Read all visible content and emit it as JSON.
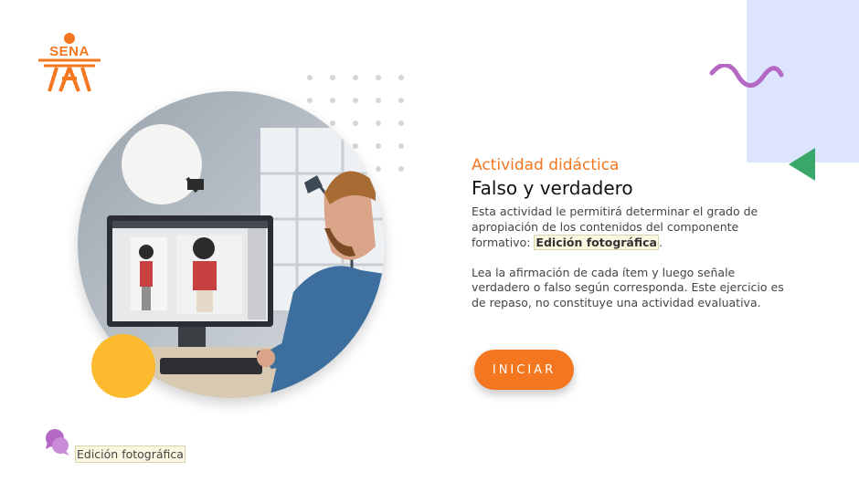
{
  "colors": {
    "brand_orange": "#f4771f",
    "accent_purple": "#b468c4",
    "light_blue": "#dce5fd",
    "green": "#3aa86b",
    "yellow": "#fcba2e",
    "dot_gray": "#d6d6d6",
    "text_dark": "#111111",
    "text_body": "#444444"
  },
  "logo": {
    "text": "SENA"
  },
  "activity": {
    "subtitle": "Actividad didáctica",
    "title": "Falso y verdadero",
    "description_prefix": "Esta actividad le permitirá determinar el grado de apropiación de los contenidos del componente formativo: ",
    "description_tag": "Edición fotográfica",
    "description_suffix": ".",
    "instructions": "Lea la afirmación de cada ítem y luego señale verdadero o falso según corresponda.  Este ejercicio es de repaso, no constituye una actividad evaluativa."
  },
  "start_button": {
    "label": "INICIAR"
  },
  "footer": {
    "label": "Edición fotográfica",
    "icon": "chat-bubbles-icon"
  },
  "decorations": {
    "photo": "photographer-editing-photo-icon",
    "wave": "wave-icon",
    "triangle": "triangle-icon"
  }
}
